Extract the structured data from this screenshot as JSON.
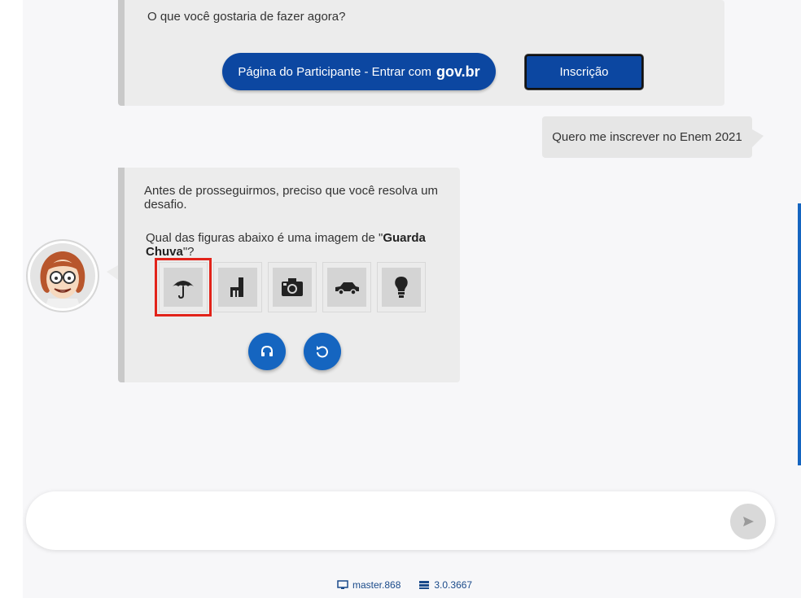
{
  "bot_message_1": {
    "text": "O que você gostaria de fazer agora?",
    "participant_button": {
      "label": "Página do Participante - Entrar com",
      "brand": "gov.br"
    },
    "inscricao_button": {
      "label": "Inscrição"
    }
  },
  "user_message": {
    "text": "Quero me inscrever no Enem 2021"
  },
  "bot_message_2": {
    "intro": "Antes de prosseguirmos, preciso que você resolva um desafio.",
    "question_prefix": "Qual das figuras abaixo é uma imagem de \"",
    "question_target": "Guarda Chuva",
    "question_suffix": "\"?",
    "captcha_options": [
      {
        "icon": "umbrella-icon",
        "selected": true
      },
      {
        "icon": "chair-icon",
        "selected": false
      },
      {
        "icon": "camera-icon",
        "selected": false
      },
      {
        "icon": "car-icon",
        "selected": false
      },
      {
        "icon": "lightbulb-icon",
        "selected": false
      }
    ],
    "audio_button_icon": "headphones-icon",
    "refresh_button_icon": "refresh-icon"
  },
  "input": {
    "placeholder": "",
    "value": "",
    "send_icon": "send-icon"
  },
  "footer": {
    "monitor_text": "master.868",
    "server_text": "3.0.3667"
  },
  "colors": {
    "primary": "#0c47a1",
    "accent": "#1565c0",
    "selection": "#e2231a",
    "bubble": "#ececec"
  }
}
